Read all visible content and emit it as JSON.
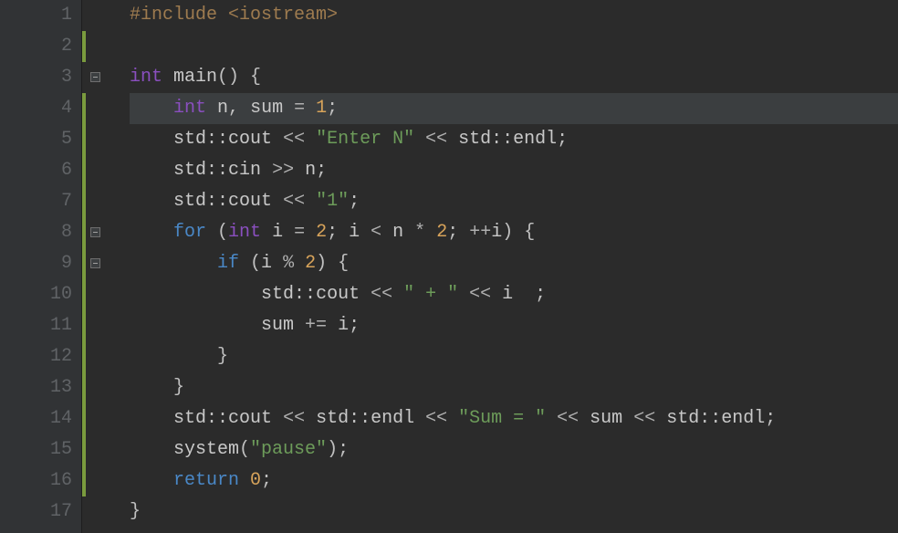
{
  "editor": {
    "highlighted_line": 4,
    "fold_markers": [
      3,
      8,
      9
    ],
    "change_bars": [
      [
        2,
        2
      ],
      [
        4,
        16
      ]
    ],
    "lines": {
      "l1": {
        "tokens": [
          {
            "t": "#include ",
            "c": "c-pre"
          },
          {
            "t": "<iostream>",
            "c": "c-pre"
          }
        ]
      },
      "l2": {
        "tokens": []
      },
      "l3": {
        "tokens": [
          {
            "t": "int ",
            "c": "c-type"
          },
          {
            "t": "main",
            "c": "c-func"
          },
          {
            "t": "() {",
            "c": "c-punc"
          }
        ]
      },
      "l4": {
        "tokens": [
          {
            "t": "    ",
            "c": ""
          },
          {
            "t": "int ",
            "c": "c-type"
          },
          {
            "t": "n",
            "c": "c-var"
          },
          {
            "t": ", ",
            "c": "c-punc"
          },
          {
            "t": "sum",
            "c": "c-var"
          },
          {
            "t": " = ",
            "c": "c-op"
          },
          {
            "t": "1",
            "c": "c-num"
          },
          {
            "t": ";",
            "c": "c-punc"
          }
        ]
      },
      "l5": {
        "tokens": [
          {
            "t": "    ",
            "c": ""
          },
          {
            "t": "std",
            "c": "c-ns"
          },
          {
            "t": "::",
            "c": "c-punc"
          },
          {
            "t": "cout",
            "c": "c-var"
          },
          {
            "t": " << ",
            "c": "c-op"
          },
          {
            "t": "\"Enter N\"",
            "c": "c-str"
          },
          {
            "t": " << ",
            "c": "c-op"
          },
          {
            "t": "std",
            "c": "c-ns"
          },
          {
            "t": "::",
            "c": "c-punc"
          },
          {
            "t": "endl",
            "c": "c-var"
          },
          {
            "t": ";",
            "c": "c-punc"
          }
        ]
      },
      "l6": {
        "tokens": [
          {
            "t": "    ",
            "c": ""
          },
          {
            "t": "std",
            "c": "c-ns"
          },
          {
            "t": "::",
            "c": "c-punc"
          },
          {
            "t": "cin",
            "c": "c-var"
          },
          {
            "t": " >> ",
            "c": "c-op"
          },
          {
            "t": "n",
            "c": "c-var"
          },
          {
            "t": ";",
            "c": "c-punc"
          }
        ]
      },
      "l7": {
        "tokens": [
          {
            "t": "    ",
            "c": ""
          },
          {
            "t": "std",
            "c": "c-ns"
          },
          {
            "t": "::",
            "c": "c-punc"
          },
          {
            "t": "cout",
            "c": "c-var"
          },
          {
            "t": " << ",
            "c": "c-op"
          },
          {
            "t": "\"1\"",
            "c": "c-str"
          },
          {
            "t": ";",
            "c": "c-punc"
          }
        ]
      },
      "l8": {
        "tokens": [
          {
            "t": "    ",
            "c": ""
          },
          {
            "t": "for ",
            "c": "c-kw"
          },
          {
            "t": "(",
            "c": "c-punc"
          },
          {
            "t": "int ",
            "c": "c-type"
          },
          {
            "t": "i",
            "c": "c-var"
          },
          {
            "t": " = ",
            "c": "c-op"
          },
          {
            "t": "2",
            "c": "c-num"
          },
          {
            "t": "; ",
            "c": "c-punc"
          },
          {
            "t": "i",
            "c": "c-var"
          },
          {
            "t": " < ",
            "c": "c-op"
          },
          {
            "t": "n",
            "c": "c-var"
          },
          {
            "t": " * ",
            "c": "c-op"
          },
          {
            "t": "2",
            "c": "c-num"
          },
          {
            "t": "; ",
            "c": "c-punc"
          },
          {
            "t": "++",
            "c": "c-op"
          },
          {
            "t": "i",
            "c": "c-var"
          },
          {
            "t": ") {",
            "c": "c-punc"
          }
        ]
      },
      "l9": {
        "tokens": [
          {
            "t": "        ",
            "c": ""
          },
          {
            "t": "if ",
            "c": "c-kw"
          },
          {
            "t": "(",
            "c": "c-punc"
          },
          {
            "t": "i",
            "c": "c-var"
          },
          {
            "t": " % ",
            "c": "c-op"
          },
          {
            "t": "2",
            "c": "c-num"
          },
          {
            "t": ") {",
            "c": "c-punc"
          }
        ]
      },
      "l10": {
        "tokens": [
          {
            "t": "            ",
            "c": ""
          },
          {
            "t": "std",
            "c": "c-ns"
          },
          {
            "t": "::",
            "c": "c-punc"
          },
          {
            "t": "cout",
            "c": "c-var"
          },
          {
            "t": " << ",
            "c": "c-op"
          },
          {
            "t": "\" + \"",
            "c": "c-str"
          },
          {
            "t": " << ",
            "c": "c-op"
          },
          {
            "t": "i",
            "c": "c-var"
          },
          {
            "t": "  ;",
            "c": "c-punc"
          }
        ]
      },
      "l11": {
        "tokens": [
          {
            "t": "            ",
            "c": ""
          },
          {
            "t": "sum",
            "c": "c-var"
          },
          {
            "t": " += ",
            "c": "c-op"
          },
          {
            "t": "i",
            "c": "c-var"
          },
          {
            "t": ";",
            "c": "c-punc"
          }
        ]
      },
      "l12": {
        "tokens": [
          {
            "t": "        }",
            "c": "c-punc"
          }
        ]
      },
      "l13": {
        "tokens": [
          {
            "t": "    }",
            "c": "c-punc"
          }
        ]
      },
      "l14": {
        "tokens": [
          {
            "t": "    ",
            "c": ""
          },
          {
            "t": "std",
            "c": "c-ns"
          },
          {
            "t": "::",
            "c": "c-punc"
          },
          {
            "t": "cout",
            "c": "c-var"
          },
          {
            "t": " << ",
            "c": "c-op"
          },
          {
            "t": "std",
            "c": "c-ns"
          },
          {
            "t": "::",
            "c": "c-punc"
          },
          {
            "t": "endl",
            "c": "c-var"
          },
          {
            "t": " << ",
            "c": "c-op"
          },
          {
            "t": "\"Sum = \"",
            "c": "c-str"
          },
          {
            "t": " << ",
            "c": "c-op"
          },
          {
            "t": "sum",
            "c": "c-var"
          },
          {
            "t": " << ",
            "c": "c-op"
          },
          {
            "t": "std",
            "c": "c-ns"
          },
          {
            "t": "::",
            "c": "c-punc"
          },
          {
            "t": "endl",
            "c": "c-var"
          },
          {
            "t": ";",
            "c": "c-punc"
          }
        ]
      },
      "l15": {
        "tokens": [
          {
            "t": "    ",
            "c": ""
          },
          {
            "t": "system",
            "c": "c-func"
          },
          {
            "t": "(",
            "c": "c-punc"
          },
          {
            "t": "\"pause\"",
            "c": "c-str"
          },
          {
            "t": ");",
            "c": "c-punc"
          }
        ]
      },
      "l16": {
        "tokens": [
          {
            "t": "    ",
            "c": ""
          },
          {
            "t": "return ",
            "c": "c-kw"
          },
          {
            "t": "0",
            "c": "c-num"
          },
          {
            "t": ";",
            "c": "c-punc"
          }
        ]
      },
      "l17": {
        "tokens": [
          {
            "t": "}",
            "c": "c-punc"
          }
        ]
      }
    },
    "line_numbers": [
      "1",
      "2",
      "3",
      "4",
      "5",
      "6",
      "7",
      "8",
      "9",
      "10",
      "11",
      "12",
      "13",
      "14",
      "15",
      "16",
      "17"
    ]
  }
}
